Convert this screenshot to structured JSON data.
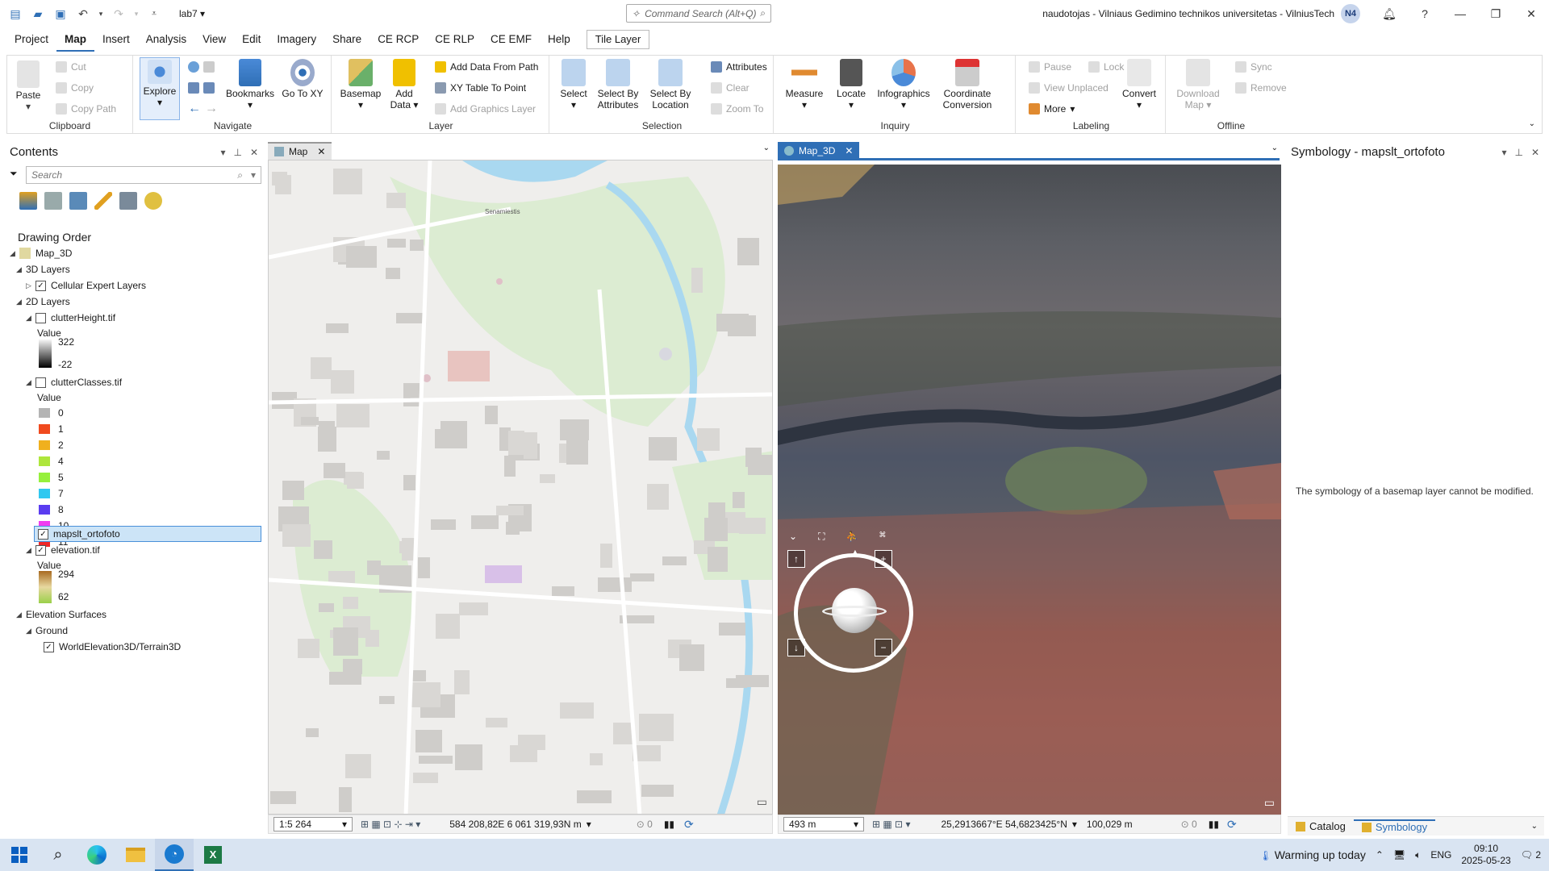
{
  "titlebar": {
    "project_name": "lab7",
    "command_search_placeholder": "Command Search (Alt+Q)",
    "org": "naudotojas - Vilniaus Gedimino technikos universitetas - VilniusTech",
    "avatar_initials": "N4"
  },
  "menu": {
    "items": [
      "Project",
      "Map",
      "Insert",
      "Analysis",
      "View",
      "Edit",
      "Imagery",
      "Share",
      "CE RCP",
      "CE RLP",
      "CE EMF",
      "Help"
    ],
    "contextual_tab": "Tile Layer"
  },
  "ribbon": {
    "clipboard": {
      "paste": "Paste",
      "cut": "Cut",
      "copy": "Copy",
      "copy_path": "Copy Path",
      "label": "Clipboard"
    },
    "navigate": {
      "explore": "Explore",
      "bookmarks": "Bookmarks",
      "go_to_xy": "Go To XY",
      "label": "Navigate"
    },
    "layer": {
      "basemap": "Basemap",
      "add_data": "Add Data",
      "add_data_from_path": "Add Data From Path",
      "xy_table_to_point": "XY Table To Point",
      "add_graphics_layer": "Add Graphics Layer",
      "label": "Layer"
    },
    "selection": {
      "select": "Select",
      "select_by_attributes": "Select By Attributes",
      "select_by_location": "Select By Location",
      "attributes": "Attributes",
      "clear": "Clear",
      "zoom_to": "Zoom To",
      "label": "Selection"
    },
    "inquiry": {
      "measure": "Measure",
      "locate": "Locate",
      "infographics": "Infographics",
      "coordinate_conversion": "Coordinate Conversion",
      "label": "Inquiry"
    },
    "labeling": {
      "pause": "Pause",
      "lock": "Lock",
      "view_unplaced": "View Unplaced",
      "more": "More",
      "convert": "Convert",
      "label": "Labeling"
    },
    "offline": {
      "download_map": "Download Map",
      "sync": "Sync",
      "remove": "Remove",
      "label": "Offline"
    }
  },
  "contents": {
    "title": "Contents",
    "search_placeholder": "Search",
    "drawing_order": "Drawing Order",
    "map": "Map_3D",
    "layers_3d": "3D Layers",
    "cellular": "Cellular Expert Layers",
    "layers_2d": "2D Layers",
    "clutter_height": "clutterHeight.tif",
    "value_label": "Value",
    "ch_max": "322",
    "ch_min": "-22",
    "clutter_classes": "clutterClasses.tif",
    "classes": [
      {
        "label": "0",
        "color": "#b4b4b4"
      },
      {
        "label": "1",
        "color": "#f04a1e"
      },
      {
        "label": "2",
        "color": "#f0b01e"
      },
      {
        "label": "4",
        "color": "#aee63c"
      },
      {
        "label": "5",
        "color": "#96f03c"
      },
      {
        "label": "7",
        "color": "#30c8f0"
      },
      {
        "label": "8",
        "color": "#5a3cf0"
      },
      {
        "label": "10",
        "color": "#f03cf0"
      },
      {
        "label": "11",
        "color": "#f02828"
      }
    ],
    "ortofoto": "mapslt_ortofoto",
    "elevation": "elevation.tif",
    "el_max": "294",
    "el_min": "62",
    "elevation_surfaces": "Elevation Surfaces",
    "ground": "Ground",
    "world_elevation": "WorldElevation3D/Terrain3D"
  },
  "map2d": {
    "tab": "Map",
    "labels": [
      "Senamiestis"
    ],
    "scale": "1:5 264",
    "coords": "584 208,82E 6 061 319,93N m",
    "selected_count": "0"
  },
  "map3d": {
    "tab": "Map_3D",
    "altitude": "493 m",
    "coords": "25,2913667°E 54,6823425°N",
    "elevation": "100,029 m",
    "selected_count": "0"
  },
  "symbology": {
    "title": "Symbology - mapslt_ortofoto",
    "message": "The symbology of a basemap layer cannot be modified.",
    "tab_catalog": "Catalog",
    "tab_symbology": "Symbology"
  },
  "taskbar": {
    "weather": "Warming up today",
    "lang": "ENG",
    "time": "09:10",
    "date": "2025-05-23",
    "notif_count": "2"
  },
  "colors": {
    "accent": "#2f6fb6",
    "selection": "#cce4f7"
  }
}
